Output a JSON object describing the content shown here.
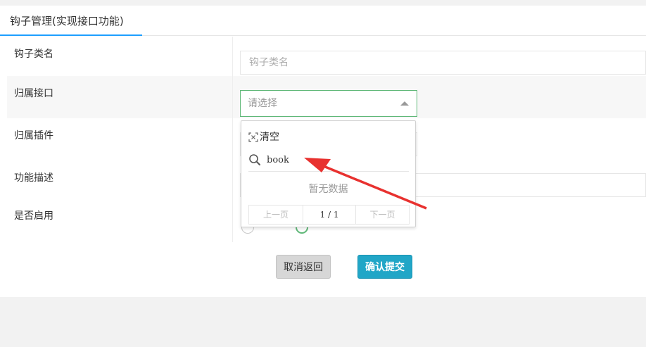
{
  "tab": {
    "label": "钩子管理(实现接口功能)"
  },
  "form": {
    "hook_class": {
      "label": "钩子类名",
      "placeholder": "钩子类名"
    },
    "interface": {
      "label": "归属接口",
      "placeholder": "请选择"
    },
    "plugin": {
      "label": "归属插件"
    },
    "description": {
      "label": "功能描述"
    },
    "enabled": {
      "label": "是否启用"
    }
  },
  "dropdown": {
    "clear_label": "清空",
    "search_value": "book",
    "empty_text": "暂无数据",
    "pager": {
      "prev": "上一页",
      "page": "1 / 1",
      "next": "下一页"
    }
  },
  "buttons": {
    "cancel": "取消返回",
    "submit": "确认提交"
  },
  "colors": {
    "accent_green": "#5fb878",
    "tab_blue": "#1e9fff",
    "submit": "#21a6c7",
    "arrow": "#e8312f"
  },
  "icons": [
    "clear-icon",
    "search-icon",
    "caret-up-icon",
    "red-arrow"
  ]
}
